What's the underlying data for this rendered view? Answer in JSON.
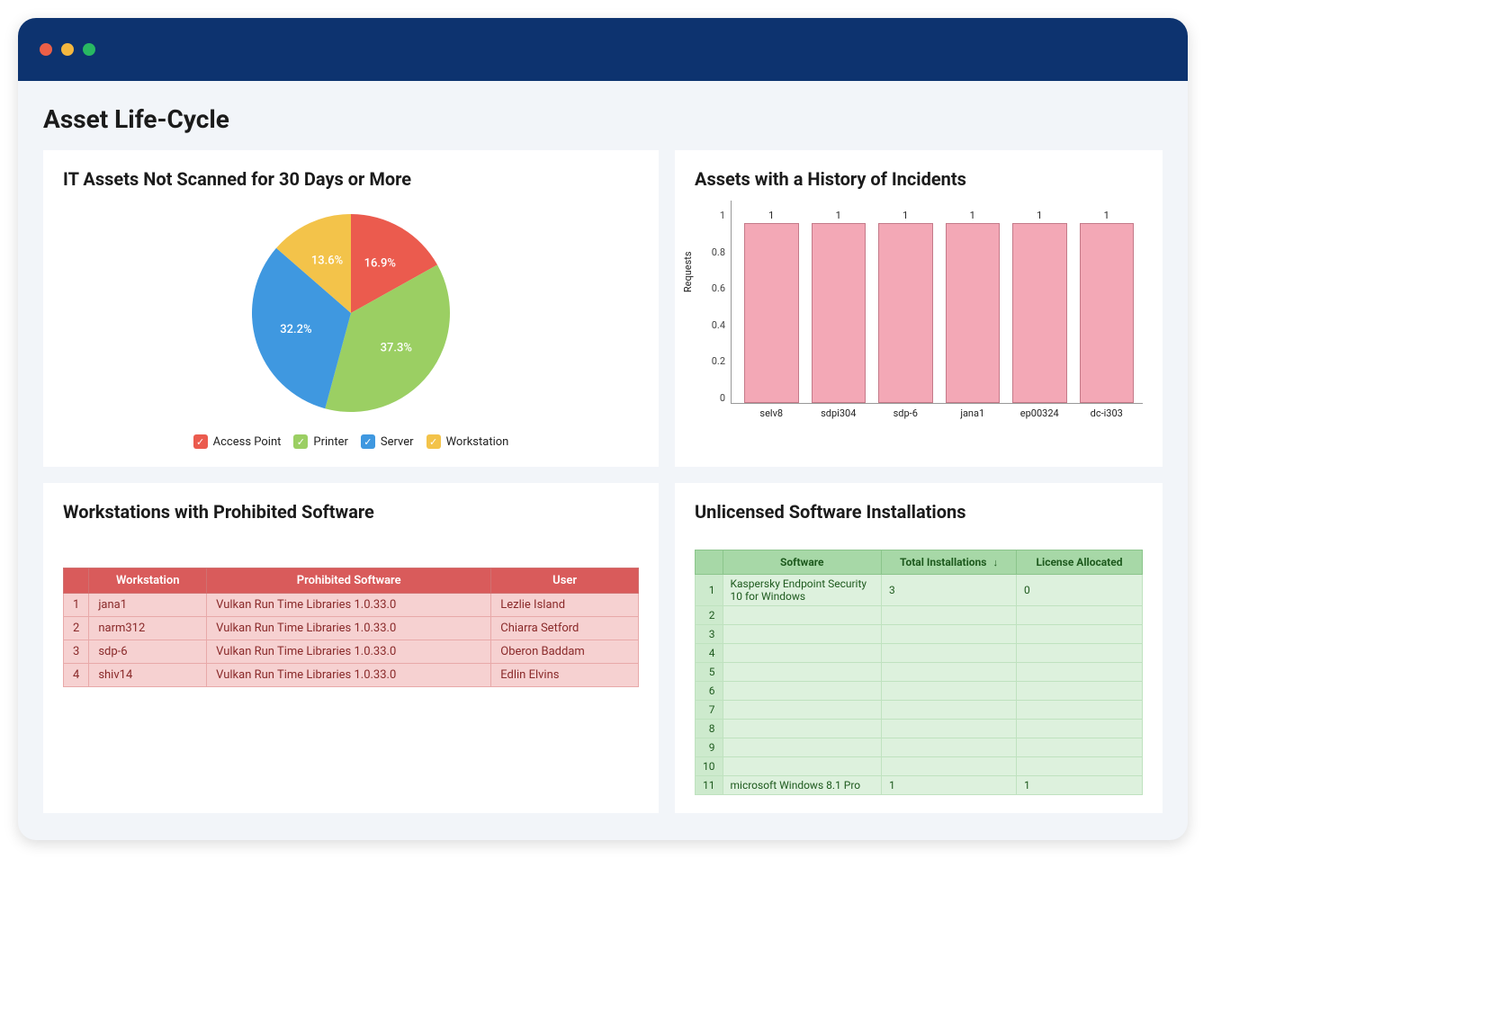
{
  "page": {
    "title": "Asset Life-Cycle"
  },
  "colors": {
    "red": "#eb5b4e",
    "green": "#9bcf63",
    "blue": "#3f98e0",
    "yellow": "#f3c34a",
    "barFill": "#f3a8b6"
  },
  "pie": {
    "title": "IT Assets Not Scanned for 30 Days or More",
    "slices": [
      {
        "label": "Access Point",
        "value": 16.9,
        "text": "16.9%",
        "color": "#eb5b4e"
      },
      {
        "label": "Printer",
        "value": 37.3,
        "text": "37.3%",
        "color": "#9bcf63"
      },
      {
        "label": "Server",
        "value": 32.2,
        "text": "32.2%",
        "color": "#3f98e0"
      },
      {
        "label": "Workstation",
        "value": 13.6,
        "text": "13.6%",
        "color": "#f3c34a"
      }
    ]
  },
  "bar": {
    "title": "Assets with a History of Incidents",
    "ylabel": "Requests",
    "ticks": [
      "0",
      "0.2",
      "0.4",
      "0.6",
      "0.8",
      "1"
    ]
  },
  "prohibited": {
    "title": "Workstations with Prohibited Software",
    "headers": [
      "",
      "Workstation",
      "Prohibited Software",
      "User"
    ],
    "rows": [
      {
        "n": "1",
        "ws": "jana1",
        "sw": "Vulkan Run Time Libraries 1.0.33.0",
        "user": "Lezlie Island"
      },
      {
        "n": "2",
        "ws": "narm312",
        "sw": "Vulkan Run Time Libraries 1.0.33.0",
        "user": "Chiarra Setford"
      },
      {
        "n": "3",
        "ws": "sdp-6",
        "sw": "Vulkan Run Time Libraries 1.0.33.0",
        "user": "Oberon Baddam"
      },
      {
        "n": "4",
        "ws": "shiv14",
        "sw": "Vulkan Run Time Libraries 1.0.33.0",
        "user": "Edlin Elvins"
      }
    ]
  },
  "unlicensed": {
    "title": "Unlicensed Software Installations",
    "headers": {
      "n": "",
      "sw": "Software",
      "inst": "Total Installations",
      "lic": "License Allocated"
    },
    "rows": [
      {
        "n": "1",
        "sw": "Kaspersky Endpoint Security 10 for Windows",
        "inst": "3",
        "lic": "0"
      },
      {
        "n": "2",
        "sw": "",
        "inst": "",
        "lic": ""
      },
      {
        "n": "3",
        "sw": "",
        "inst": "",
        "lic": ""
      },
      {
        "n": "4",
        "sw": "",
        "inst": "",
        "lic": ""
      },
      {
        "n": "5",
        "sw": "",
        "inst": "",
        "lic": ""
      },
      {
        "n": "6",
        "sw": "",
        "inst": "",
        "lic": ""
      },
      {
        "n": "7",
        "sw": "",
        "inst": "",
        "lic": ""
      },
      {
        "n": "8",
        "sw": "",
        "inst": "",
        "lic": ""
      },
      {
        "n": "9",
        "sw": "",
        "inst": "",
        "lic": ""
      },
      {
        "n": "10",
        "sw": "",
        "inst": "",
        "lic": ""
      },
      {
        "n": "11",
        "sw": "microsoft Windows 8.1 Pro",
        "inst": "1",
        "lic": "1"
      }
    ]
  },
  "chart_data": [
    {
      "type": "pie",
      "title": "IT Assets Not Scanned for 30 Days or More",
      "categories": [
        "Access Point",
        "Printer",
        "Server",
        "Workstation"
      ],
      "values": [
        16.9,
        37.3,
        32.2,
        13.6
      ],
      "colors": [
        "#eb5b4e",
        "#9bcf63",
        "#3f98e0",
        "#f3c34a"
      ],
      "unit": "percent"
    },
    {
      "type": "bar",
      "title": "Assets with a History of Incidents",
      "xlabel": "",
      "ylabel": "Requests",
      "categories": [
        "selv8",
        "sdpi304",
        "sdp-6",
        "jana1",
        "ep00324",
        "dc-i303"
      ],
      "values": [
        1,
        1,
        1,
        1,
        1,
        1
      ],
      "ylim": [
        0,
        1
      ]
    },
    {
      "type": "table",
      "title": "Workstations with Prohibited Software",
      "columns": [
        "Workstation",
        "Prohibited Software",
        "User"
      ],
      "rows": [
        [
          "jana1",
          "Vulkan Run Time Libraries 1.0.33.0",
          "Lezlie Island"
        ],
        [
          "narm312",
          "Vulkan Run Time Libraries 1.0.33.0",
          "Chiarra Setford"
        ],
        [
          "sdp-6",
          "Vulkan Run Time Libraries 1.0.33.0",
          "Oberon Baddam"
        ],
        [
          "shiv14",
          "Vulkan Run Time Libraries 1.0.33.0",
          "Edlin Elvins"
        ]
      ]
    },
    {
      "type": "table",
      "title": "Unlicensed Software Installations",
      "columns": [
        "Software",
        "Total Installations",
        "License Allocated"
      ],
      "rows": [
        [
          "Kaspersky Endpoint Security 10 for Windows",
          3,
          0
        ],
        [
          "microsoft Windows 8.1 Pro",
          1,
          1
        ]
      ]
    }
  ]
}
